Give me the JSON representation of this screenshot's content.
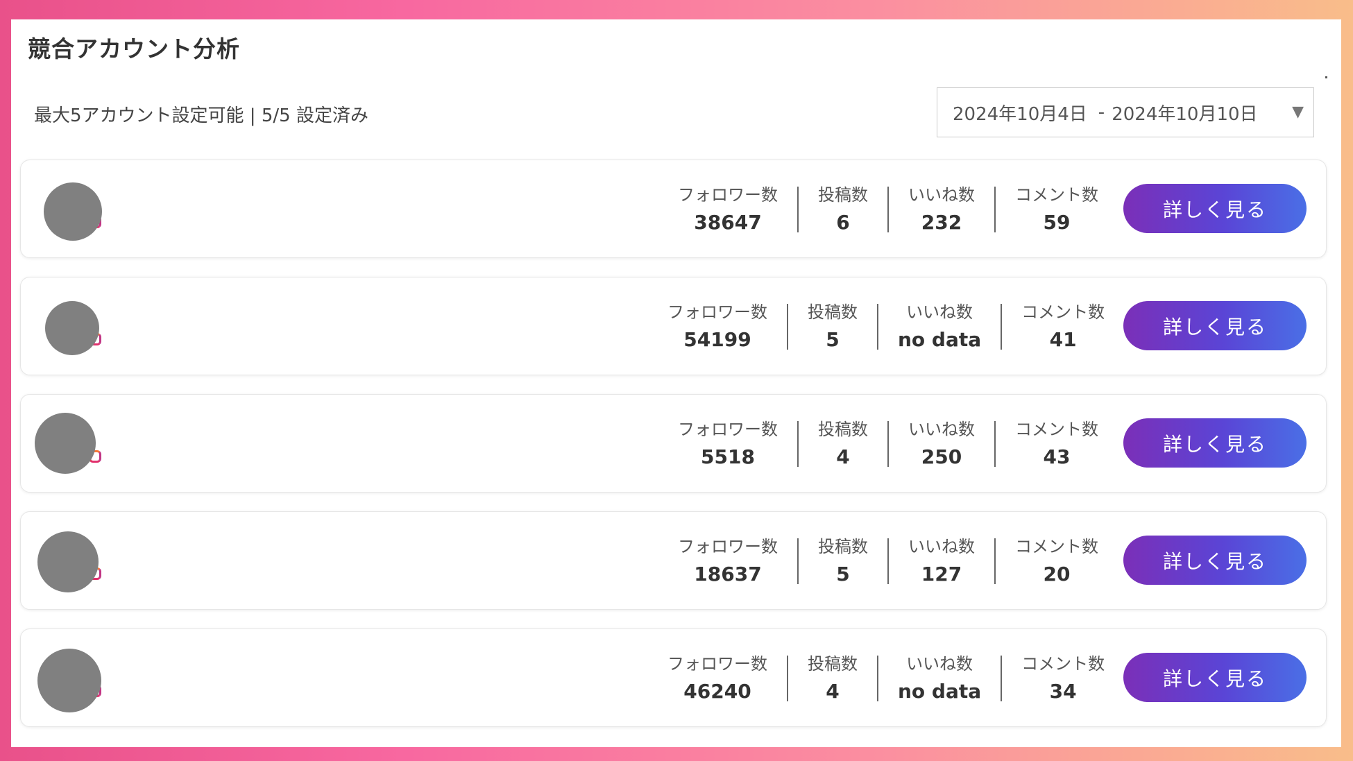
{
  "title": "競合アカウント分析",
  "subtitle": "最大5アカウント設定可能 | 5/5 設定済み",
  "date_range": {
    "start": "2024年10月4日",
    "separator": "-",
    "end": "2024年10月10日",
    "caret_icon": "triangle-down-icon"
  },
  "labels": {
    "followers": "フォロワー数",
    "posts": "投稿数",
    "likes": "いいね数",
    "comments": "コメント数",
    "detail_button": "詳しく見る"
  },
  "accounts": [
    {
      "followers": "38647",
      "posts": "6",
      "likes": "232",
      "comments": "59"
    },
    {
      "followers": "54199",
      "posts": "5",
      "likes": "no data",
      "comments": "41"
    },
    {
      "followers": "5518",
      "posts": "4",
      "likes": "250",
      "comments": "43"
    },
    {
      "followers": "18637",
      "posts": "5",
      "likes": "127",
      "comments": "20"
    },
    {
      "followers": "46240",
      "posts": "4",
      "likes": "no data",
      "comments": "34"
    }
  ],
  "colors": {
    "button_gradient_start": "#7b2fb8",
    "button_gradient_end": "#4a6fe6",
    "avatar_placeholder": "#808080"
  }
}
